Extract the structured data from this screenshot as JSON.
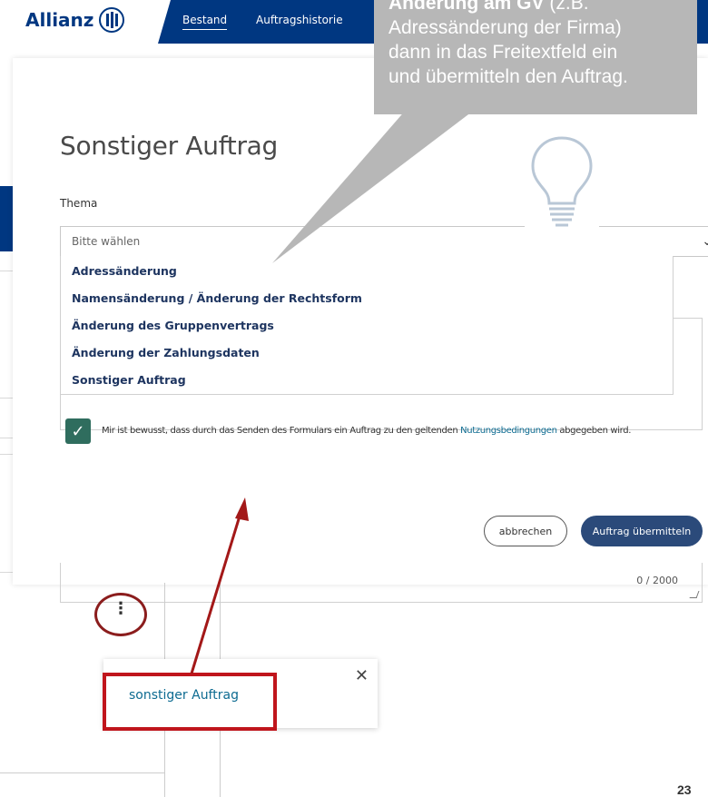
{
  "brand": {
    "name": "Allianz"
  },
  "nav": {
    "items": [
      "Bestand",
      "Auftragshistorie"
    ]
  },
  "modal": {
    "title": "Sonstiger Auftrag",
    "field_label": "Thema",
    "select_placeholder": "Bitte wählen",
    "options": [
      "Adressänderung",
      "Namensänderung / Änderung der Rechtsform",
      "Änderung des Gruppenvertrags",
      "Änderung der Zahlungsdaten",
      "Sonstiger Auftrag"
    ],
    "consent_before": "Mir ist bewusst, dass durch das Senden des Formulars ein Auftrag zu den geltenden ",
    "consent_link": "Nutzungsbedingungen",
    "consent_after": " abgegeben wird.",
    "consent_checked": true,
    "cancel_label": "abbrechen",
    "submit_label": "Auftrag übermitteln",
    "char_counter": "0 / 2000"
  },
  "popup": {
    "link_label": "sonstiger Auftrag",
    "close_icon": "close-icon"
  },
  "callout": {
    "bold": "Änderung am GV",
    "line1_rest": "  (z.B.",
    "line2": "Adressänderung der Firma)",
    "line3": "dann in das Freitextfeld ein",
    "line4": "und übermitteln den Auftrag."
  },
  "page_number": "23",
  "colors": {
    "brand_blue": "#003781",
    "checkbox_green": "#2f6d5e",
    "annotation_red": "#c0151c",
    "callout_gray": "#b7b7b7"
  }
}
